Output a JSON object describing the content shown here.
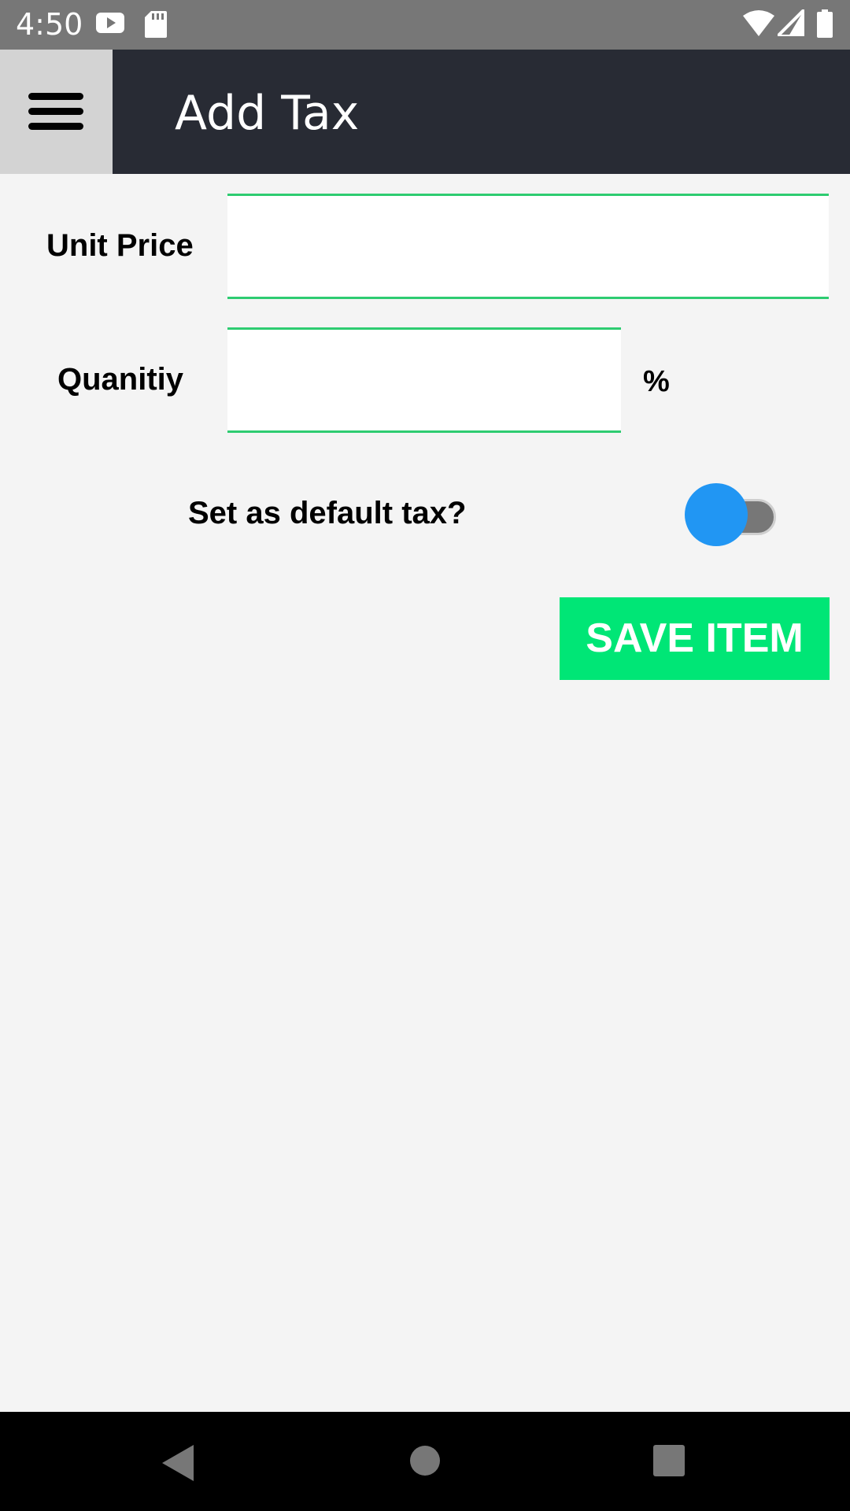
{
  "status_bar": {
    "time": "4:50",
    "icons": [
      "youtube-notification-icon",
      "sd-card-icon",
      "wifi-icon",
      "cell-signal-icon",
      "battery-icon"
    ]
  },
  "app_bar": {
    "title": "Add Tax",
    "menu_icon": "hamburger-menu-icon",
    "background": "#282b34"
  },
  "form": {
    "unit_price": {
      "label": "Unit Price",
      "value": "",
      "placeholder": ""
    },
    "quantity": {
      "label": "Quanitiy",
      "value": "",
      "placeholder": "",
      "suffix": "%"
    },
    "default_tax": {
      "label": "Set as default tax?",
      "checked": true
    },
    "save_label": "SAVE ITEM"
  },
  "colors": {
    "accent_green": "#00e676",
    "field_border": "#2ecc71",
    "toggle_thumb": "#2196f3"
  },
  "nav_bar": {
    "icons": [
      "back-icon",
      "home-icon",
      "recents-icon"
    ]
  }
}
